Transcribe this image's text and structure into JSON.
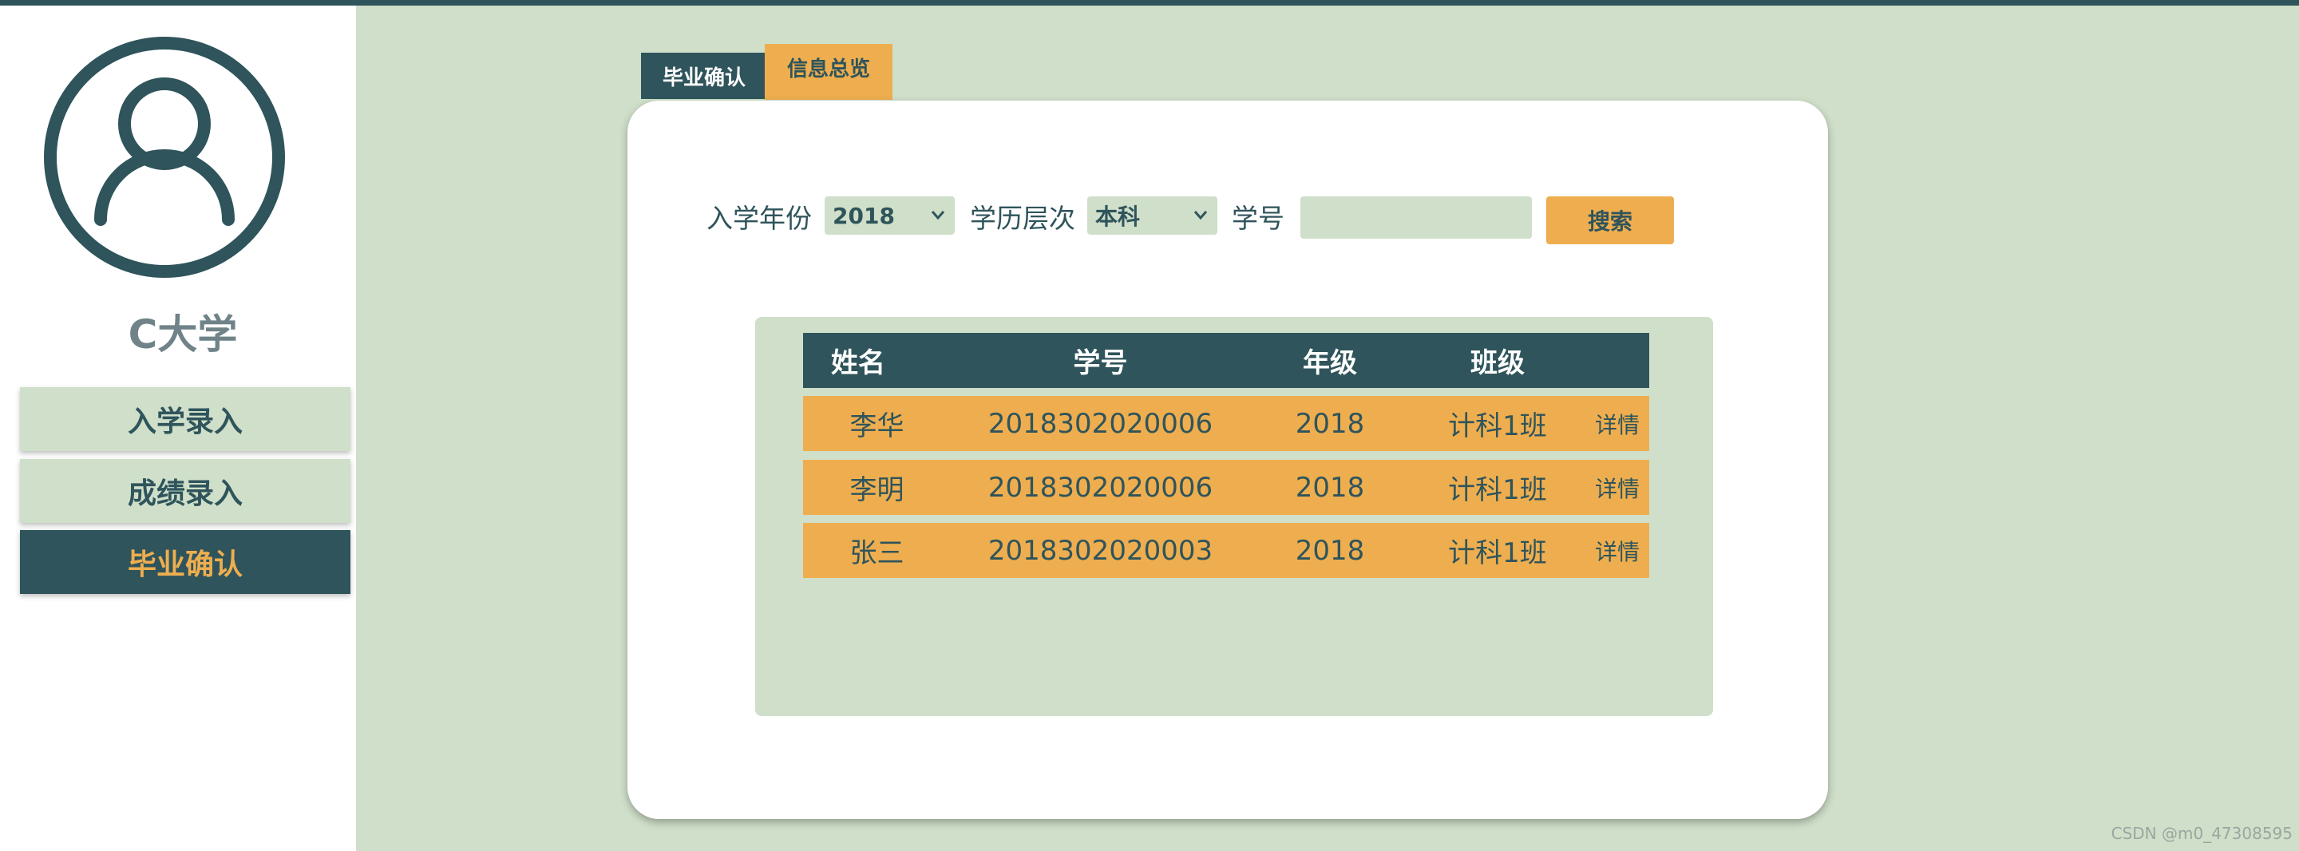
{
  "app": {
    "university_name": "C大学",
    "watermark": "CSDN @m0_47308595"
  },
  "colors": {
    "primary": "#2f545b",
    "accent": "#eeae4f",
    "background": "#cfdfc9",
    "card": "#ffffff"
  },
  "sidebar": {
    "avatar_icon": "user-avatar-icon",
    "items": [
      {
        "label": "入学录入",
        "active": false
      },
      {
        "label": "成绩录入",
        "active": false
      },
      {
        "label": "毕业确认",
        "active": true
      }
    ]
  },
  "tabs": [
    {
      "label": "毕业确认",
      "active": true
    },
    {
      "label": "信息总览",
      "active": false
    }
  ],
  "filters": {
    "year_label": "入学年份",
    "year_value": "2018",
    "level_label": "学历层次",
    "level_value": "本科",
    "id_label": "学号",
    "id_value": "",
    "search_label": "搜索"
  },
  "table": {
    "headers": [
      "姓名",
      "学号",
      "年级",
      "班级"
    ],
    "rows": [
      {
        "name": "李华",
        "id": "2018302020006",
        "grade": "2018",
        "class": "计科1班",
        "action": "详情"
      },
      {
        "name": "李明",
        "id": "2018302020006",
        "grade": "2018",
        "class": "计科1班",
        "action": "详情"
      },
      {
        "name": "张三",
        "id": "2018302020003",
        "grade": "2018",
        "class": "计科1班",
        "action": "详情"
      }
    ]
  }
}
